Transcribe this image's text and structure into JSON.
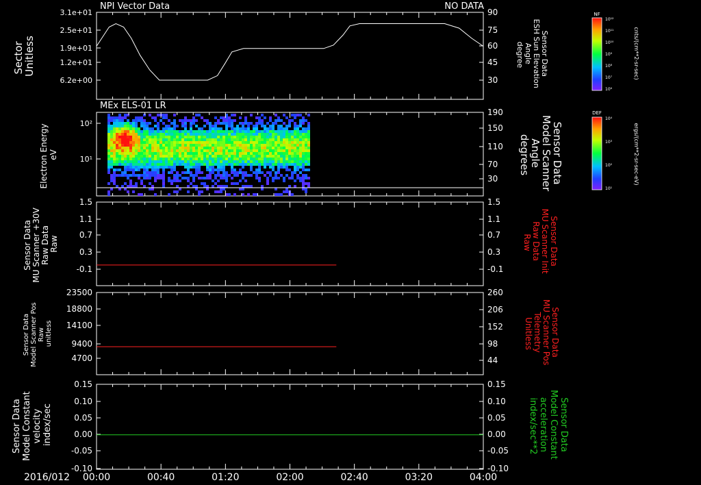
{
  "date_label": "2016/012",
  "time_ticks": [
    "00:00",
    "00:40",
    "01:20",
    "02:00",
    "02:40",
    "03:20",
    "04:00"
  ],
  "chart_data": [
    {
      "type": "line",
      "title": "NPI Vector Data",
      "status": "NO DATA",
      "ylabel_left": [
        "Sector",
        "Unitless"
      ],
      "yticks_left": [
        "3.1e+01",
        "2.5e+01",
        "1.9e+01",
        "1.2e+01",
        "6.2e+00"
      ],
      "ylabel_right": [
        "Sensor Data",
        "ESH Sun Elevation",
        "Angle",
        "degree"
      ],
      "yticks_right": [
        "90",
        "75",
        "60",
        "45",
        "30"
      ],
      "ylim_right": [
        18,
        90
      ],
      "series": [
        {
          "color": "#ffffff",
          "x_hours": [
            0,
            0.13,
            0.2,
            0.28,
            0.36,
            0.45,
            0.55,
            0.65,
            0.82,
            0.97,
            1.05,
            1.15,
            1.25,
            1.33,
            1.4,
            1.52,
            1.85,
            2.05,
            2.2,
            2.35,
            2.45,
            2.55,
            2.62,
            2.72,
            2.85,
            3.02,
            3.2,
            3.45,
            3.6,
            3.75,
            3.88,
            4.0
          ],
          "y": [
            60,
            77,
            80,
            77,
            67,
            52,
            39,
            30,
            30,
            30,
            30,
            30,
            34,
            45,
            55,
            58,
            58,
            58,
            58,
            58,
            61,
            70,
            78,
            80,
            80,
            80,
            80,
            80,
            80,
            76,
            67,
            60
          ]
        }
      ]
    },
    {
      "type": "heatmap",
      "title": "MEx ELS-01 LR",
      "ylabel_left": [
        "Electron Energy",
        "eV"
      ],
      "yticks_left": [
        "10²",
        "10¹"
      ],
      "ylabel_right": [
        "Sensor Data",
        "Model Scanner",
        "Angle",
        "degrees"
      ],
      "yticks_right": [
        "190",
        "150",
        "110",
        "70",
        "30"
      ],
      "data_end_hours": 2.3,
      "colorbar": {
        "label": "DEF",
        "units": "ergs/(cm**2-sr-sec-eV)",
        "ticks": [
          "10⁴",
          "10³",
          "10²",
          "10¹"
        ]
      }
    },
    {
      "type": "line",
      "ylabel_left": [
        "Sensor Data",
        "MU Scanner +30V",
        "Raw Data",
        "Raw"
      ],
      "yticks_left": [
        "1.5",
        "1.1",
        "0.7",
        "0.3",
        "-0.1"
      ],
      "ylabel_right": [
        "Sensor Data",
        "MU Scanner Init",
        "Raw Data",
        "Raw"
      ],
      "yticks_right": [
        "1.5",
        "1.1",
        "0.7",
        "0.3",
        "-0.1"
      ],
      "ylim": [
        -0.4,
        1.5
      ],
      "series": [
        {
          "color": "#ff2020",
          "x_hours": [
            0,
            2.48
          ],
          "y": [
            0,
            0
          ]
        }
      ]
    },
    {
      "type": "line",
      "ylabel_left": [
        "Sensor Data",
        "Model Scanner Pos",
        "Raw",
        "unitless"
      ],
      "yticks_left": [
        "23500",
        "18800",
        "14100",
        "9400",
        "4700"
      ],
      "ylabel_right": [
        "Sensor Data",
        "MU Scanner Pos",
        "Telemetry",
        "Unitless"
      ],
      "yticks_right": [
        "260",
        "206",
        "152",
        "98",
        "44"
      ],
      "ylim": [
        0,
        23500
      ],
      "series": [
        {
          "color": "#ff2020",
          "x_hours": [
            0,
            2.48
          ],
          "y": [
            8000,
            8000
          ]
        }
      ]
    },
    {
      "type": "line",
      "ylabel_left": [
        "Sensor Data",
        "Model Constant",
        "velocity",
        "index/sec"
      ],
      "yticks_left": [
        "0.15",
        "0.10",
        "0.05",
        "0.00",
        "-0.05",
        "-0.10"
      ],
      "ylabel_right": [
        "Sensor Data",
        "Model Constant",
        "acceleration",
        "index/sec**2"
      ],
      "yticks_right": [
        "0.15",
        "0.10",
        "0.05",
        "0.00",
        "-0.05",
        "-0.10"
      ],
      "ylim": [
        -0.1,
        0.15
      ],
      "series": [
        {
          "color": "#22cc22",
          "x_hours": [
            0,
            4
          ],
          "y": [
            0,
            0
          ]
        }
      ]
    }
  ],
  "colorbar_nf": {
    "label": "NF",
    "units": "cnts/(cm**2-sr-sec)",
    "ticks": [
      "10¹²",
      "10¹¹",
      "10¹⁰",
      "10⁹",
      "10⁸",
      "10⁷",
      "10⁶"
    ]
  },
  "colors": {
    "panel1_right_label": "#ffffff",
    "panel3_right_label": "#ff2020",
    "panel4_right_label": "#ff2020",
    "panel5_right_label": "#22cc22"
  }
}
